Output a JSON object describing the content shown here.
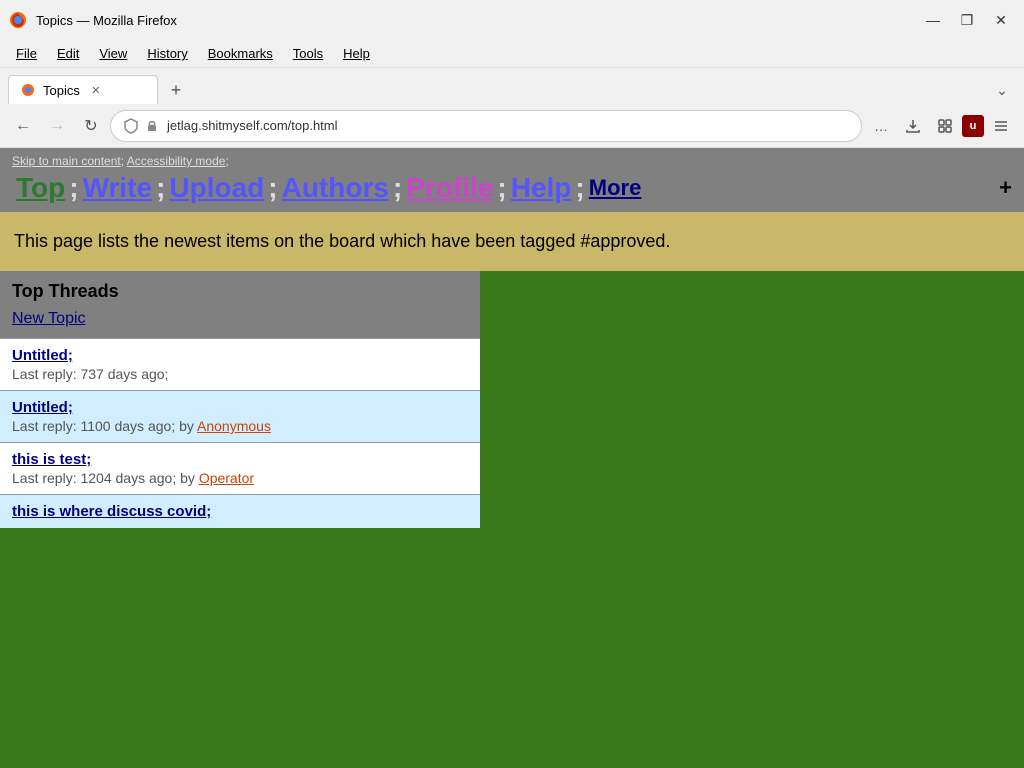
{
  "browser": {
    "title": "Topics — Mozilla Firefox",
    "tab_label": "Topics",
    "url": "jetlag.shitmyself.com/top.html"
  },
  "menu": {
    "items": [
      "File",
      "Edit",
      "View",
      "History",
      "Bookmarks",
      "Tools",
      "Help"
    ]
  },
  "nav_links": {
    "skip_main": "Skip to main content",
    "accessibility": "Accessibility mode",
    "top": "Top",
    "write": "Write",
    "upload": "Upload",
    "authors": "Authors",
    "profile": "Profile",
    "help": "Help",
    "more": "More",
    "plus": "+"
  },
  "description": {
    "text": "This page lists the newest items on the board which have been tagged #approved."
  },
  "threads": {
    "header": "Top Threads",
    "new_topic": "New Topic",
    "items": [
      {
        "title": "Untitled",
        "meta_label": "Last reply:",
        "meta_value": "737 days ago;",
        "by": "",
        "author": "",
        "bg": "white"
      },
      {
        "title": "Untitled",
        "meta_label": "Last reply:",
        "meta_value": "1100 days ago;",
        "by": "by",
        "author": "Anonymous",
        "bg": "light-blue"
      },
      {
        "title": "this is test",
        "meta_label": "Last reply:",
        "meta_value": "1204 days ago;",
        "by": "by",
        "author": "Operator",
        "bg": "white"
      },
      {
        "title": "this is where discuss covid",
        "meta_label": "",
        "meta_value": "",
        "by": "",
        "author": "",
        "bg": "light-blue"
      }
    ]
  },
  "title_controls": {
    "minimize": "—",
    "maximize": "❐",
    "close": "✕"
  }
}
